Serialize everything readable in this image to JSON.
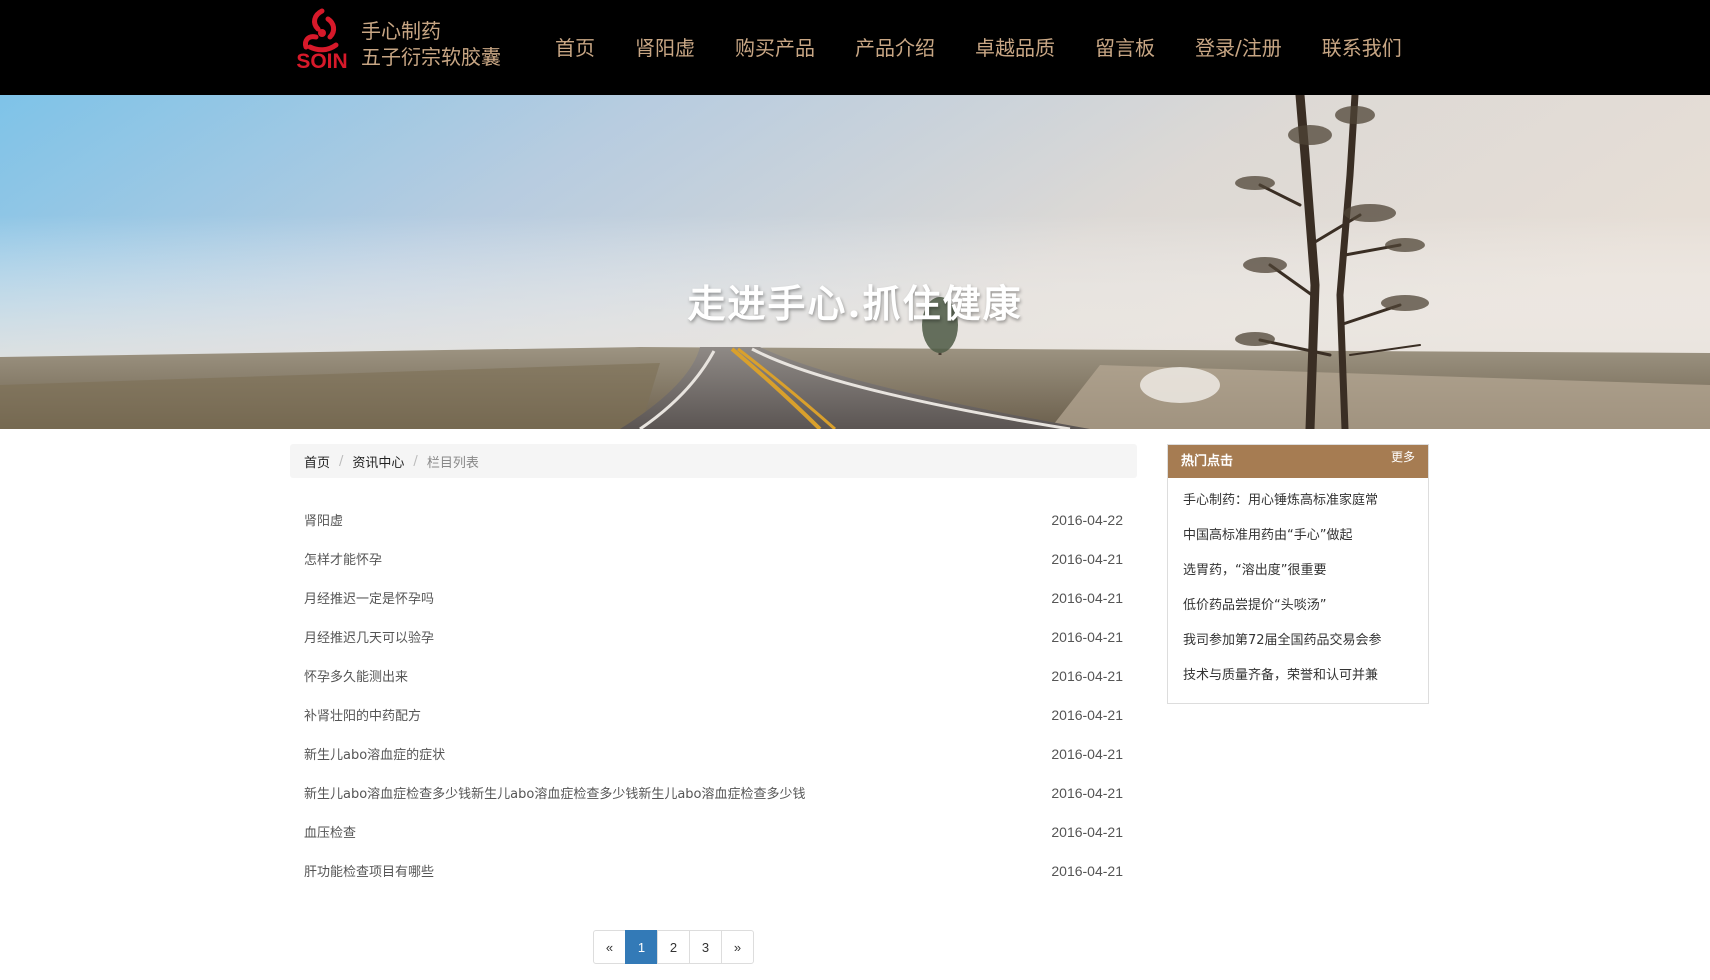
{
  "brand": {
    "logo_text": "SOIN",
    "line1": "手心制药",
    "line2": "五子衍宗软胶囊"
  },
  "nav": [
    {
      "label": "首页"
    },
    {
      "label": "肾阳虚"
    },
    {
      "label": "购买产品"
    },
    {
      "label": "产品介绍"
    },
    {
      "label": "卓越品质"
    },
    {
      "label": "留言板"
    },
    {
      "label": "登录/注册"
    },
    {
      "label": "联系我们"
    }
  ],
  "banner": {
    "title": "走进手心.抓住健康"
  },
  "breadcrumb": {
    "home": "首页",
    "section": "资讯中心",
    "current": "栏目列表",
    "separator": "/"
  },
  "articles": [
    {
      "title": "肾阳虚",
      "date": "2016-04-22"
    },
    {
      "title": "怎样才能怀孕",
      "date": "2016-04-21"
    },
    {
      "title": "月经推迟一定是怀孕吗",
      "date": "2016-04-21"
    },
    {
      "title": "月经推迟几天可以验孕",
      "date": "2016-04-21"
    },
    {
      "title": "怀孕多久能测出来",
      "date": "2016-04-21"
    },
    {
      "title": "补肾壮阳的中药配方",
      "date": "2016-04-21"
    },
    {
      "title": "新生儿abo溶血症的症状",
      "date": "2016-04-21"
    },
    {
      "title": "新生儿abo溶血症检查多少钱新生儿abo溶血症检查多少钱新生儿abo溶血症检查多少钱",
      "date": "2016-04-21"
    },
    {
      "title": "血压检查",
      "date": "2016-04-21"
    },
    {
      "title": "肝功能检查项目有哪些",
      "date": "2016-04-21"
    }
  ],
  "pagination": {
    "prev": "«",
    "pages": [
      "1",
      "2",
      "3"
    ],
    "current": "1",
    "next": "»"
  },
  "sidebar": {
    "title": "热门点击",
    "more": "更多",
    "items": [
      {
        "label": "手心制药：用心锤炼高标准家庭常"
      },
      {
        "label": "中国高标准用药由“手心”做起"
      },
      {
        "label": "选胃药，“溶出度”很重要"
      },
      {
        "label": "低价药品尝提价“头啖汤”"
      },
      {
        "label": "我司参加第72届全国药品交易会参"
      },
      {
        "label": "技术与质量齐备，荣誉和认可并兼"
      }
    ]
  },
  "colors": {
    "nav_bg": "#000000",
    "nav_text": "#c8a684",
    "logo_red": "#d7192a",
    "sidebar_head": "#a67c52",
    "page_active": "#337ab7"
  }
}
